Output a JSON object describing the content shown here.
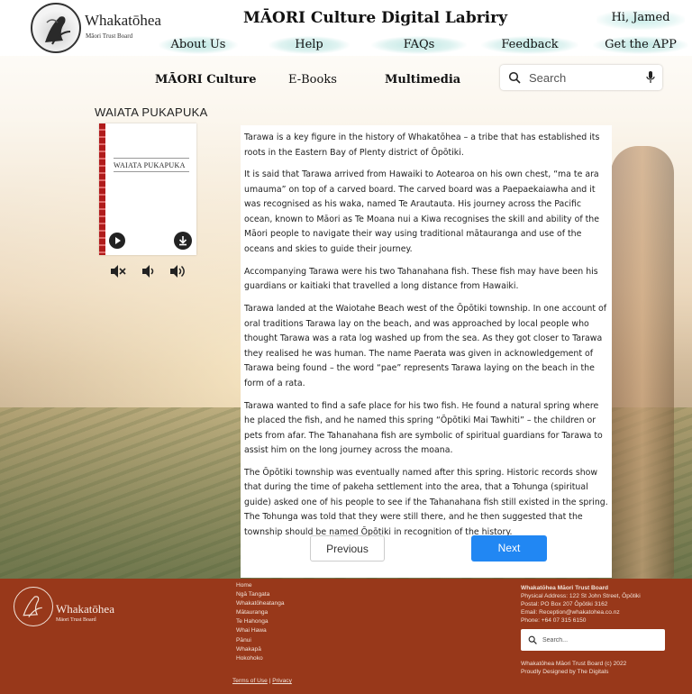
{
  "header": {
    "logo_title": "Whakatōhea",
    "logo_subtitle": "Māori Trust Board",
    "site_title": "MĀORI Culture Digital Labriry",
    "greeting": "Hi, Jamed",
    "nav": [
      "About Us",
      "Help",
      "FAQs",
      "Feedback",
      "Get the APP"
    ]
  },
  "subnav": {
    "items": [
      "MĀORI Culture",
      "E-Books",
      "Multimedia"
    ],
    "search_placeholder": "Search"
  },
  "song": {
    "title": "WAIATA PUKAPUKA",
    "card_title": "WAIATA PUKAPUKA"
  },
  "icons": {
    "mute": "volume-mute-icon",
    "vol_down": "volume-down-icon",
    "vol_up": "volume-up-icon",
    "play": "play-icon",
    "download": "download-icon"
  },
  "article": {
    "paragraphs": [
      "Tarawa is a key figure in the history of Whakatōhea – a tribe that has established its roots in the Eastern Bay of Plenty district of Ōpōtiki.",
      "It is said that Tarawa arrived from Hawaiki to Aotearoa on his own chest, “ma te ara umauma” on top of a carved board. The carved board was a Paepaekaiawha and it was recognised as his waka, named Te Arautauta. His journey across the Pacific ocean, known to Māori as Te Moana nui a Kiwa recognises the skill and ability of the Māori people to navigate their way using traditional mātauranga and use of the oceans and skies to guide their journey.",
      "Accompanying Tarawa were his two Tahanahana fish. These fish may have been his guardians or kaitiaki that travelled a long distance from Hawaiki.",
      "Tarawa landed at the Waiotahe Beach west of the Ōpōtiki township. In one account of oral traditions Tarawa lay on the beach, and was approached by local people who thought Tarawa was a rata log washed up from the sea. As they got closer to Tarawa they realised he was human. The name Paerata was given in acknowledgement of Tarawa being found – the word “pae” represents Tarawa laying on the beach in the form of a rata.",
      "Tarawa wanted to find a safe place for his two fish. He found a natural spring where he placed the fish, and he named this spring “Ōpōtiki Mai Tawhiti” – the children or pets from afar. The Tahanahana fish are symbolic of spiritual guardians for Tarawa to assist him on the long journey across the moana.",
      "The Ōpōtiki township was eventually named after this spring. Historic records show that during the time of pakeha settlement into the area, that a Tohunga (spiritual guide) asked one of his people to see if the Tahanahana fish still existed in the spring. The Tohunga was told that they were still there, and he then suggested that the township should be named Ōpōtiki in recognition of the history."
    ]
  },
  "pagination": {
    "previous": "Previous",
    "next": "Next"
  },
  "colors": {
    "accent": "#2187f3",
    "footer_bg": "#98381a",
    "nav_highlight": "#bfe7e3"
  },
  "footer": {
    "logo_title": "Whakatōhea",
    "logo_subtitle": "Māori Trust Board",
    "links": [
      "Home",
      "Ngā Tangata",
      "Whakatōheatanga",
      "Mātauranga",
      "Te Hahonga",
      "Whai Hawa",
      "Pānui",
      "Whakapā",
      "Hokohoko"
    ],
    "terms": "Terms of Use",
    "separator": "|",
    "privacy": "Privacy",
    "org_name": "Whakatōhea Māori Trust Board",
    "physical_address": "Physical Address: 122 St John Street, Ōpōtiki",
    "postal": "Postal: PO Box 207 Ōpōtiki 3162",
    "email": "Email: Reception@whakatohea.co.nz",
    "phone": "Phone: +64 07 315 6150",
    "search_placeholder": "Search...",
    "copyright": "Whakatōhea Māori Trust Board (c) 2022",
    "credits": "Proudly Designed by The Digitals"
  }
}
